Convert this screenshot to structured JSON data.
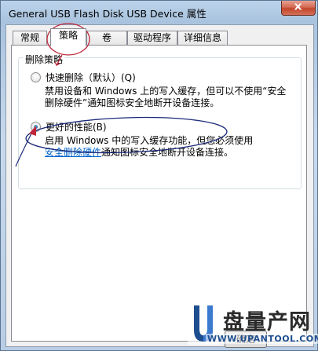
{
  "window": {
    "title": "General USB Flash Disk USB Device 属性",
    "close_glyph": "X"
  },
  "tabs": [
    {
      "label": "常规",
      "active": false
    },
    {
      "label": "策略",
      "active": true
    },
    {
      "label": "卷",
      "active": false
    },
    {
      "label": "驱动程序",
      "active": false
    },
    {
      "label": "详细信息",
      "active": false
    }
  ],
  "removal_policy": {
    "group_label": "删除策略",
    "quick": {
      "label": "快速删除（默认）(Q)",
      "selected": false,
      "desc_line1": "禁用设备和 Windows 上的写入缓存，但可以不使用“安全",
      "desc_line2": "删除硬件”通知图标安全地断开设备连接。"
    },
    "better": {
      "label": "更好的性能(B)",
      "selected": true,
      "desc_line1": "启用 Windows 中的写入缓存功能，但您必须使用",
      "desc_link": "安全删除硬件",
      "desc_line2_rest": "通知图标安全地断开设备连接。"
    }
  },
  "buttons": {
    "ok_partial": "确定"
  },
  "watermark": {
    "text": "盘量产网",
    "url": "WWW.UPANTOOL.COM"
  },
  "colors": {
    "annotation": "#c0283c",
    "ellipse": "#1c2a7a",
    "link": "#0066cc"
  }
}
